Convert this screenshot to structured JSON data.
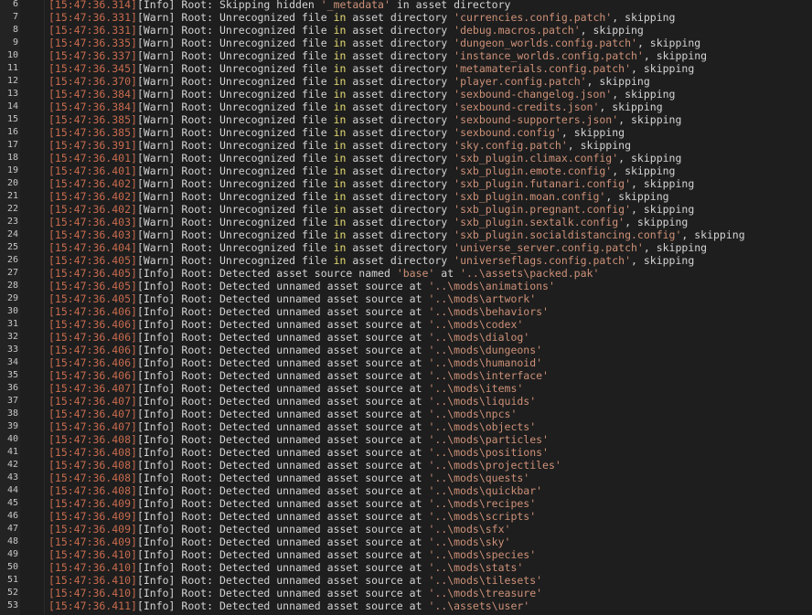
{
  "log": {
    "lines": [
      {
        "n": "6",
        "ts": "[15:47:36.314]",
        "lvl": "[Info]",
        "pre": " Root: Skipping hidden ",
        "str": "'_metadata'",
        "mid": " in asset directory",
        "post": ""
      },
      {
        "n": "7",
        "ts": "[15:47:36.331]",
        "lvl": "[Warn]",
        "pre": " Root: Unrecognized file ",
        "kw": "in",
        "mid2": " asset directory ",
        "str": "'currencies.config.patch'",
        "post": ", skipping"
      },
      {
        "n": "8",
        "ts": "[15:47:36.331]",
        "lvl": "[Warn]",
        "pre": " Root: Unrecognized file ",
        "kw": "in",
        "mid2": " asset directory ",
        "str": "'debug.macros.patch'",
        "post": ", skipping"
      },
      {
        "n": "9",
        "ts": "[15:47:36.335]",
        "lvl": "[Warn]",
        "pre": " Root: Unrecognized file ",
        "kw": "in",
        "mid2": " asset directory ",
        "str": "'dungeon_worlds.config.patch'",
        "post": ", skipping"
      },
      {
        "n": "10",
        "ts": "[15:47:36.337]",
        "lvl": "[Warn]",
        "pre": " Root: Unrecognized file ",
        "kw": "in",
        "mid2": " asset directory ",
        "str": "'instance_worlds.config.patch'",
        "post": ", skipping"
      },
      {
        "n": "11",
        "ts": "[15:47:36.345]",
        "lvl": "[Warn]",
        "pre": " Root: Unrecognized file ",
        "kw": "in",
        "mid2": " asset directory ",
        "str": "'metamaterials.config.patch'",
        "post": ", skipping"
      },
      {
        "n": "12",
        "ts": "[15:47:36.370]",
        "lvl": "[Warn]",
        "pre": " Root: Unrecognized file ",
        "kw": "in",
        "mid2": " asset directory ",
        "str": "'player.config.patch'",
        "post": ", skipping"
      },
      {
        "n": "13",
        "ts": "[15:47:36.384]",
        "lvl": "[Warn]",
        "pre": " Root: Unrecognized file ",
        "kw": "in",
        "mid2": " asset directory ",
        "str": "'sexbound-changelog.json'",
        "post": ", skipping"
      },
      {
        "n": "14",
        "ts": "[15:47:36.384]",
        "lvl": "[Warn]",
        "pre": " Root: Unrecognized file ",
        "kw": "in",
        "mid2": " asset directory ",
        "str": "'sexbound-credits.json'",
        "post": ", skipping"
      },
      {
        "n": "15",
        "ts": "[15:47:36.385]",
        "lvl": "[Warn]",
        "pre": " Root: Unrecognized file ",
        "kw": "in",
        "mid2": " asset directory ",
        "str": "'sexbound-supporters.json'",
        "post": ", skipping"
      },
      {
        "n": "16",
        "ts": "[15:47:36.385]",
        "lvl": "[Warn]",
        "pre": " Root: Unrecognized file ",
        "kw": "in",
        "mid2": " asset directory ",
        "str": "'sexbound.config'",
        "post": ", skipping"
      },
      {
        "n": "17",
        "ts": "[15:47:36.391]",
        "lvl": "[Warn]",
        "pre": " Root: Unrecognized file ",
        "kw": "in",
        "mid2": " asset directory ",
        "str": "'sky.config.patch'",
        "post": ", skipping"
      },
      {
        "n": "18",
        "ts": "[15:47:36.401]",
        "lvl": "[Warn]",
        "pre": " Root: Unrecognized file ",
        "kw": "in",
        "mid2": " asset directory ",
        "str": "'sxb_plugin.climax.config'",
        "post": ", skipping"
      },
      {
        "n": "19",
        "ts": "[15:47:36.401]",
        "lvl": "[Warn]",
        "pre": " Root: Unrecognized file ",
        "kw": "in",
        "mid2": " asset directory ",
        "str": "'sxb_plugin.emote.config'",
        "post": ", skipping"
      },
      {
        "n": "20",
        "ts": "[15:47:36.402]",
        "lvl": "[Warn]",
        "pre": " Root: Unrecognized file ",
        "kw": "in",
        "mid2": " asset directory ",
        "str": "'sxb_plugin.futanari.config'",
        "post": ", skipping"
      },
      {
        "n": "21",
        "ts": "[15:47:36.402]",
        "lvl": "[Warn]",
        "pre": " Root: Unrecognized file ",
        "kw": "in",
        "mid2": " asset directory ",
        "str": "'sxb_plugin.moan.config'",
        "post": ", skipping"
      },
      {
        "n": "22",
        "ts": "[15:47:36.402]",
        "lvl": "[Warn]",
        "pre": " Root: Unrecognized file ",
        "kw": "in",
        "mid2": " asset directory ",
        "str": "'sxb_plugin.pregnant.config'",
        "post": ", skipping"
      },
      {
        "n": "23",
        "ts": "[15:47:36.403]",
        "lvl": "[Warn]",
        "pre": " Root: Unrecognized file ",
        "kw": "in",
        "mid2": " asset directory ",
        "str": "'sxb_plugin.sextalk.config'",
        "post": ", skipping"
      },
      {
        "n": "24",
        "ts": "[15:47:36.403]",
        "lvl": "[Warn]",
        "pre": " Root: Unrecognized file ",
        "kw": "in",
        "mid2": " asset directory ",
        "str": "'sxb_plugin.socialdistancing.config'",
        "post": ", skipping"
      },
      {
        "n": "25",
        "ts": "[15:47:36.404]",
        "lvl": "[Warn]",
        "pre": " Root: Unrecognized file ",
        "kw": "in",
        "mid2": " asset directory ",
        "str": "'universe_server.config.patch'",
        "post": ", skipping"
      },
      {
        "n": "26",
        "ts": "[15:47:36.405]",
        "lvl": "[Warn]",
        "pre": " Root: Unrecognized file ",
        "kw": "in",
        "mid2": " asset directory ",
        "str": "'universeflags.config.patch'",
        "post": ", skipping"
      },
      {
        "n": "27",
        "ts": "[15:47:36.405]",
        "lvl": "[Info]",
        "pre": " Root: Detected asset source named ",
        "str": "'base'",
        "mid": " at ",
        "str2": "'..\\assets\\packed.pak'",
        "post": ""
      },
      {
        "n": "28",
        "ts": "[15:47:36.405]",
        "lvl": "[Info]",
        "pre": " Root: Detected unnamed asset source at ",
        "str": "'..\\mods\\animations'",
        "post": ""
      },
      {
        "n": "29",
        "ts": "[15:47:36.405]",
        "lvl": "[Info]",
        "pre": " Root: Detected unnamed asset source at ",
        "str": "'..\\mods\\artwork'",
        "post": ""
      },
      {
        "n": "30",
        "ts": "[15:47:36.406]",
        "lvl": "[Info]",
        "pre": " Root: Detected unnamed asset source at ",
        "str": "'..\\mods\\behaviors'",
        "post": ""
      },
      {
        "n": "31",
        "ts": "[15:47:36.406]",
        "lvl": "[Info]",
        "pre": " Root: Detected unnamed asset source at ",
        "str": "'..\\mods\\codex'",
        "post": ""
      },
      {
        "n": "32",
        "ts": "[15:47:36.406]",
        "lvl": "[Info]",
        "pre": " Root: Detected unnamed asset source at ",
        "str": "'..\\mods\\dialog'",
        "post": ""
      },
      {
        "n": "33",
        "ts": "[15:47:36.406]",
        "lvl": "[Info]",
        "pre": " Root: Detected unnamed asset source at ",
        "str": "'..\\mods\\dungeons'",
        "post": ""
      },
      {
        "n": "34",
        "ts": "[15:47:36.406]",
        "lvl": "[Info]",
        "pre": " Root: Detected unnamed asset source at ",
        "str": "'..\\mods\\humanoid'",
        "post": ""
      },
      {
        "n": "35",
        "ts": "[15:47:36.406]",
        "lvl": "[Info]",
        "pre": " Root: Detected unnamed asset source at ",
        "str": "'..\\mods\\interface'",
        "post": ""
      },
      {
        "n": "36",
        "ts": "[15:47:36.407]",
        "lvl": "[Info]",
        "pre": " Root: Detected unnamed asset source at ",
        "str": "'..\\mods\\items'",
        "post": ""
      },
      {
        "n": "37",
        "ts": "[15:47:36.407]",
        "lvl": "[Info]",
        "pre": " Root: Detected unnamed asset source at ",
        "str": "'..\\mods\\liquids'",
        "post": ""
      },
      {
        "n": "38",
        "ts": "[15:47:36.407]",
        "lvl": "[Info]",
        "pre": " Root: Detected unnamed asset source at ",
        "str": "'..\\mods\\npcs'",
        "post": ""
      },
      {
        "n": "39",
        "ts": "[15:47:36.407]",
        "lvl": "[Info]",
        "pre": " Root: Detected unnamed asset source at ",
        "str": "'..\\mods\\objects'",
        "post": ""
      },
      {
        "n": "40",
        "ts": "[15:47:36.408]",
        "lvl": "[Info]",
        "pre": " Root: Detected unnamed asset source at ",
        "str": "'..\\mods\\particles'",
        "post": ""
      },
      {
        "n": "41",
        "ts": "[15:47:36.408]",
        "lvl": "[Info]",
        "pre": " Root: Detected unnamed asset source at ",
        "str": "'..\\mods\\positions'",
        "post": ""
      },
      {
        "n": "42",
        "ts": "[15:47:36.408]",
        "lvl": "[Info]",
        "pre": " Root: Detected unnamed asset source at ",
        "str": "'..\\mods\\projectiles'",
        "post": ""
      },
      {
        "n": "43",
        "ts": "[15:47:36.408]",
        "lvl": "[Info]",
        "pre": " Root: Detected unnamed asset source at ",
        "str": "'..\\mods\\quests'",
        "post": ""
      },
      {
        "n": "44",
        "ts": "[15:47:36.408]",
        "lvl": "[Info]",
        "pre": " Root: Detected unnamed asset source at ",
        "str": "'..\\mods\\quickbar'",
        "post": ""
      },
      {
        "n": "45",
        "ts": "[15:47:36.409]",
        "lvl": "[Info]",
        "pre": " Root: Detected unnamed asset source at ",
        "str": "'..\\mods\\recipes'",
        "post": ""
      },
      {
        "n": "46",
        "ts": "[15:47:36.409]",
        "lvl": "[Info]",
        "pre": " Root: Detected unnamed asset source at ",
        "str": "'..\\mods\\scripts'",
        "post": ""
      },
      {
        "n": "47",
        "ts": "[15:47:36.409]",
        "lvl": "[Info]",
        "pre": " Root: Detected unnamed asset source at ",
        "str": "'..\\mods\\sfx'",
        "post": ""
      },
      {
        "n": "48",
        "ts": "[15:47:36.409]",
        "lvl": "[Info]",
        "pre": " Root: Detected unnamed asset source at ",
        "str": "'..\\mods\\sky'",
        "post": ""
      },
      {
        "n": "49",
        "ts": "[15:47:36.410]",
        "lvl": "[Info]",
        "pre": " Root: Detected unnamed asset source at ",
        "str": "'..\\mods\\species'",
        "post": ""
      },
      {
        "n": "50",
        "ts": "[15:47:36.410]",
        "lvl": "[Info]",
        "pre": " Root: Detected unnamed asset source at ",
        "str": "'..\\mods\\stats'",
        "post": ""
      },
      {
        "n": "51",
        "ts": "[15:47:36.410]",
        "lvl": "[Info]",
        "pre": " Root: Detected unnamed asset source at ",
        "str": "'..\\mods\\tilesets'",
        "post": ""
      },
      {
        "n": "52",
        "ts": "[15:47:36.410]",
        "lvl": "[Info]",
        "pre": " Root: Detected unnamed asset source at ",
        "str": "'..\\mods\\treasure'",
        "post": ""
      },
      {
        "n": "53",
        "ts": "[15:47:36.411]",
        "lvl": "[Info]",
        "pre": " Root: Detected unnamed asset source at ",
        "str": "'..\\assets\\user'",
        "post": ""
      }
    ]
  },
  "colors": {
    "background": "#1e1e1e",
    "timestamp": "#c86b4e",
    "keyword": "#e6db74",
    "string": "#ce9178",
    "text": "#d4d4d4"
  }
}
